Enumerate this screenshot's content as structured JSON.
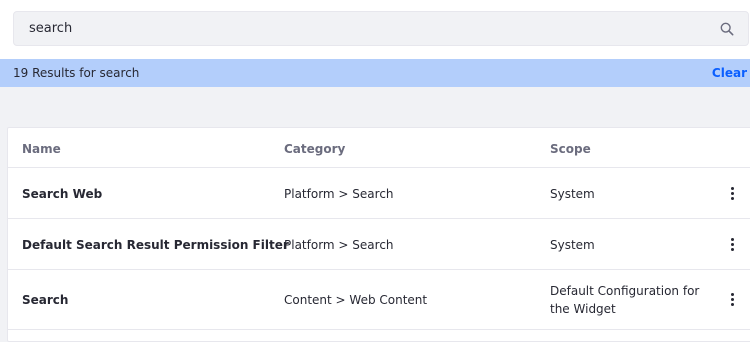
{
  "search": {
    "value": "search",
    "icon": "search-icon"
  },
  "results": {
    "text": "19 Results for search",
    "clear_label": "Clear"
  },
  "table": {
    "headers": {
      "name": "Name",
      "category": "Category",
      "scope": "Scope"
    },
    "rows": [
      {
        "name": "Search Web",
        "category": "Platform > Search",
        "scope": "System"
      },
      {
        "name": "Default Search Result Permission Filter",
        "category": "Platform > Search",
        "scope": "System"
      },
      {
        "name": "Search",
        "category": "Content > Web Content",
        "scope": "Default Configuration for the Widget"
      }
    ]
  },
  "colors": {
    "results_bar": "#b3cefb",
    "link": "#0b5fff",
    "background": "#f1f2f5"
  }
}
